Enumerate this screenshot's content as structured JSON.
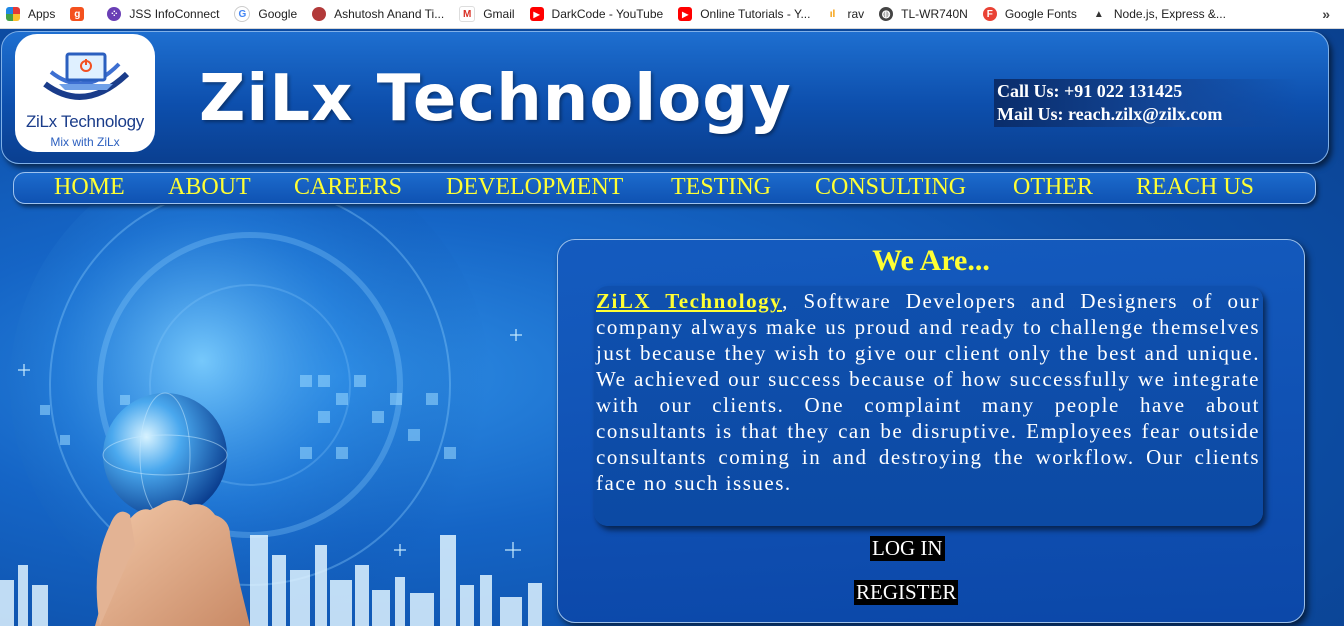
{
  "bookmarks": [
    {
      "label": "Apps",
      "icon": "apps-grid-icon",
      "color": "#e53935"
    },
    {
      "label": "",
      "icon": "g-icon",
      "color": "#f4511e"
    },
    {
      "label": "JSS InfoConnect",
      "icon": "dots-icon",
      "color": "#6a3fb5"
    },
    {
      "label": "Google",
      "icon": "google-icon",
      "color": "#4285f4"
    },
    {
      "label": "Ashutosh Anand Ti...",
      "icon": "avatar-icon",
      "color": "#b23a3a"
    },
    {
      "label": "Gmail",
      "icon": "gmail-icon",
      "color": "#d93025"
    },
    {
      "label": "DarkCode - YouTube",
      "icon": "youtube-icon",
      "color": "#ff0000"
    },
    {
      "label": "Online Tutorials - Y...",
      "icon": "youtube-icon",
      "color": "#ff0000"
    },
    {
      "label": "rav",
      "icon": "chart-icon",
      "color": "#f59e0b"
    },
    {
      "label": "TL-WR740N",
      "icon": "globe-icon",
      "color": "#444444"
    },
    {
      "label": "Google Fonts",
      "icon": "google-fonts-icon",
      "color": "#e94235"
    },
    {
      "label": "Node.js, Express &...",
      "icon": "node-icon",
      "color": "#333333"
    }
  ],
  "header": {
    "logo_name": "ZiLx Technology",
    "logo_tagline": "Mix with ZiLx",
    "brand": "ZiLx Technology",
    "call": "Call Us: +91 022 131425",
    "mail": "Mail Us: reach.zilx@zilx.com"
  },
  "nav": [
    "HOME",
    "ABOUT",
    "CAREERS",
    "DEVELOPMENT",
    "TESTING",
    "CONSULTING",
    "OTHER",
    "REACH US"
  ],
  "about": {
    "title": "We Are...",
    "link": "ZiLX Technology",
    "text": ", Software Developers and Designers of our company always make us proud and ready to challenge themselves just because they wish to give our client only the best and unique. We achieved our success because of how successfully we integrate with our clients. One complaint many people have about consultants is that they can be disruptive. Employees fear outside consultants coming in and destroying the workflow. Our clients face no such issues.",
    "login": "LOG IN",
    "register": "REGISTER"
  },
  "colors": {
    "accent": "#ffff33",
    "background": "#0d4fa8"
  }
}
